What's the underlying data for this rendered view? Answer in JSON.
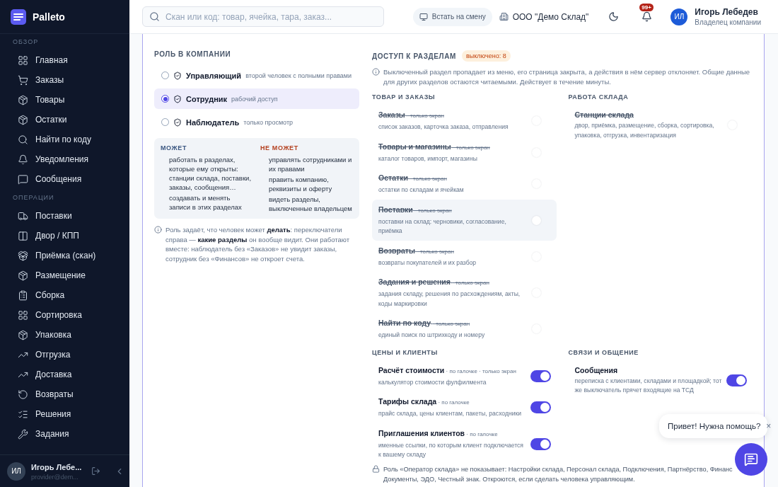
{
  "app": {
    "name": "Palleto"
  },
  "sidebar": {
    "groups": [
      {
        "label": "ОБЗОР",
        "items": [
          {
            "label": "Главная"
          },
          {
            "label": "Заказы"
          },
          {
            "label": "Товары"
          },
          {
            "label": "Остатки"
          },
          {
            "label": "Найти по коду"
          },
          {
            "label": "Уведомления"
          },
          {
            "label": "Сообщения"
          }
        ]
      },
      {
        "label": "ОПЕРАЦИИ",
        "items": [
          {
            "label": "Поставки"
          },
          {
            "label": "Двор / КПП"
          },
          {
            "label": "Приёмка (скан)"
          },
          {
            "label": "Размещение"
          },
          {
            "label": "Сборка"
          },
          {
            "label": "Сортировка"
          },
          {
            "label": "Упаковка"
          },
          {
            "label": "Отгрузка"
          },
          {
            "label": "Доставка"
          },
          {
            "label": "Возвраты"
          },
          {
            "label": "Решения"
          },
          {
            "label": "Задания"
          }
        ]
      }
    ],
    "user": {
      "initials": "ИЛ",
      "name": "Игорь Лебе...",
      "email": "provider@dem..."
    }
  },
  "header": {
    "search": {
      "placeholder": "Скан или код: товар, ячейка, тара, заказ..."
    },
    "shift_button": "Встать на смену",
    "company": "ООО \"Демо Склад\"",
    "notifications_badge": "99+",
    "user": {
      "initials": "ИЛ",
      "name": "Игорь Лебедев",
      "role": "Владелец компании"
    }
  },
  "role_panel": {
    "title": "РОЛЬ В КОМПАНИИ",
    "roles": [
      {
        "name": "Управляющий",
        "hint": "второй человек с полными правами",
        "selected": false
      },
      {
        "name": "Сотрудник",
        "hint": "рабочий доступ",
        "selected": true
      },
      {
        "name": "Наблюдатель",
        "hint": "только просмотр",
        "selected": false
      }
    ],
    "can": {
      "title": "МОЖЕТ",
      "items": [
        "работать в разделах, которые ему открыты: станции склада, поставки, заказы, сообщения…",
        "создавать и менять записи в этих разделах"
      ]
    },
    "cannot": {
      "title": "НЕ МОЖЕТ",
      "items": [
        "управлять сотрудниками и их правами",
        "править компанию, реквизиты и оферту",
        "видеть разделы, выключенные владельцем"
      ]
    },
    "note": "Роль задаёт, что человек может **делать**: переключатели справа — **какие разделы** он вообще видит. Они работают вместе: наблюдатель без «Заказов» не увидит заказы, сотрудник без «Финансов» не откроет счета."
  },
  "access_panel": {
    "title": "ДОСТУП К РАЗДЕЛАМ",
    "badge": "выключено: 8",
    "info": "Выключенный раздел пропадает из меню, его страница закрыта, а действия в нём сервер отклоняет. Общие данные для других разделов остаются читаемыми. Действует в течение минуты.",
    "groups": [
      {
        "title": "ТОВАР И ЗАКАЗЫ",
        "items": [
          {
            "name": "Заказы",
            "tags": "· только экран",
            "desc": "список заказов, карточка заказа, отправления",
            "on": false,
            "highlighted": false
          },
          {
            "name": "Товары и магазины",
            "tags": "· только экран",
            "desc": "каталог товаров, импорт, магазины",
            "on": false,
            "highlighted": false
          },
          {
            "name": "Остатки",
            "tags": "· только экран",
            "desc": "остатки по складам и ячейкам",
            "on": false,
            "highlighted": false
          },
          {
            "name": "Поставки",
            "tags": "· только экран",
            "desc": "поставки на склад: черновики, согласование, приёмка",
            "on": false,
            "highlighted": true
          },
          {
            "name": "Возвраты",
            "tags": "· только экран",
            "desc": "возвраты покупателей и их разбор",
            "on": false,
            "highlighted": false
          },
          {
            "name": "Задания и решения",
            "tags": "· только экран",
            "desc": "задания складу, решения по расхождениям, акты, коды маркировки",
            "on": false,
            "highlighted": false
          },
          {
            "name": "Найти по коду",
            "tags": "· только экран",
            "desc": "единый поиск по штрихкоду и номеру",
            "on": false,
            "highlighted": false
          }
        ]
      },
      {
        "title": "РАБОТА СКЛАДА",
        "items": [
          {
            "name": "Станции склада",
            "desc": "двор, приёмка, размещение, сборка, сортировка, упаковка, отгрузка, инвентаризация",
            "on": false,
            "highlighted": false
          }
        ]
      },
      {
        "title": "ЦЕНЫ И КЛИЕНТЫ",
        "items": [
          {
            "name": "Расчёт стоимости",
            "tags": "· по галочке · только экран",
            "desc": "калькулятор стоимости фулфилмента",
            "on": true,
            "highlighted": false
          },
          {
            "name": "Тарифы склада",
            "tags": "· по галочке",
            "desc": "прайс склада, цены клиентам, пакеты, расходники",
            "on": true,
            "highlighted": false
          },
          {
            "name": "Приглашения клиентов",
            "tags": "· по галочке",
            "desc": "именные ссылки, по которым клиент подключается к вашему складу",
            "on": true,
            "highlighted": false
          }
        ]
      },
      {
        "title": "СВЯЗИ И ОБЩЕНИЕ",
        "items": [
          {
            "name": "Сообщения",
            "desc": "переписка с клиентами, складами и площадкой; тот же выключатель прячет входящие на ТСД",
            "on": true,
            "highlighted": false
          }
        ]
      }
    ],
    "footer_lines": [
      "Роль «Оператор склада» не показывает: Настройки склада, Персонал склада, Подключения, Партнёрство, Финанс",
      "Документы, ЭДО, Честный знак. Откроются, если сделать человека управляющим."
    ]
  },
  "chat": {
    "greeting": "Привет! Нужна помощь?",
    "close": "×"
  }
}
